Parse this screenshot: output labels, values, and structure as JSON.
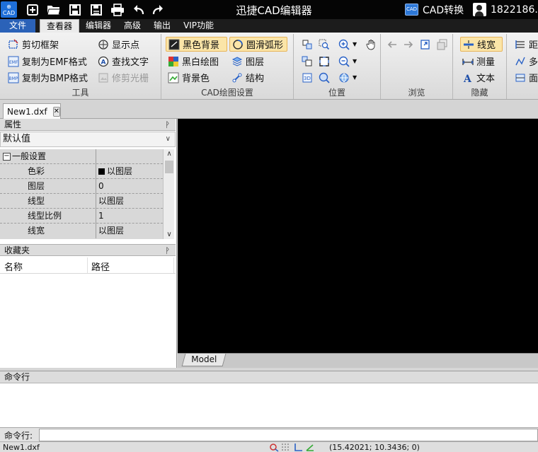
{
  "titlebar": {
    "logo_text": "CAD",
    "title": "迅捷CAD编辑器",
    "cad_convert_badge": "CAD",
    "cad_convert_label": "CAD转换",
    "user_name": "1822186...",
    "quick_actions": [
      "new-icon",
      "open-folder-icon",
      "save-icon",
      "save-as-icon",
      "print-icon",
      "undo-icon",
      "redo-icon"
    ]
  },
  "menu": {
    "tabs": [
      {
        "label": "文件",
        "state": "file"
      },
      {
        "label": "查看器",
        "state": "active"
      },
      {
        "label": "编辑器",
        "state": "normal"
      },
      {
        "label": "高级",
        "state": "normal"
      },
      {
        "label": "输出",
        "state": "normal"
      },
      {
        "label": "VIP功能",
        "state": "normal"
      }
    ]
  },
  "ribbon": {
    "tools": {
      "label": "工具",
      "clip_frame": "剪切框架",
      "copy_emf": "复制为EMF格式",
      "copy_bmp": "复制为BMP格式",
      "show_points": "显示点",
      "find_text": "查找文字",
      "trim_raster": "修剪光栅"
    },
    "cad_settings": {
      "label": "CAD绘图设置",
      "black_bg": "黑色背景",
      "smooth_arc": "圆滑弧形",
      "bw_drawing": "黑白绘图",
      "layers": "图层",
      "bg_color": "背景色",
      "structure": "结构"
    },
    "position": {
      "label": "位置"
    },
    "browse": {
      "label": "浏览"
    },
    "hide": {
      "label": "隐藏",
      "line_width": "线宽",
      "measure": "测量",
      "text": "文本"
    },
    "overflow": {
      "distance": "距",
      "multi": "多",
      "area": "面"
    }
  },
  "document": {
    "tab_name": "New1.dxf",
    "close_glyph": "✕"
  },
  "properties": {
    "header": "属性",
    "pin": "ᚹ",
    "selector_value": "默认值",
    "category": "一般设置",
    "rows": [
      {
        "name": "色彩",
        "value": "以图层",
        "swatch": "#000000"
      },
      {
        "name": "图层",
        "value": "0"
      },
      {
        "name": "线型",
        "value": "以图层"
      },
      {
        "name": "线型比例",
        "value": "1"
      },
      {
        "name": "线宽",
        "value": "以图层"
      }
    ]
  },
  "favorites": {
    "header": "收藏夹",
    "col_name": "名称",
    "col_path": "路径"
  },
  "canvas": {
    "background": "#000000",
    "layout_tab": "Model"
  },
  "command": {
    "panel_header": "命令行",
    "prompt_label": "命令行:",
    "input_value": ""
  },
  "status": {
    "file": "New1.dxf",
    "coords": "(15.42021; 10.3436; 0)"
  },
  "colors": {
    "titlebar_bg": "#050505",
    "file_tab_bg": "#2b62b8",
    "highlight_bg": "#fbe5a8",
    "canvas_bg": "#000000"
  }
}
